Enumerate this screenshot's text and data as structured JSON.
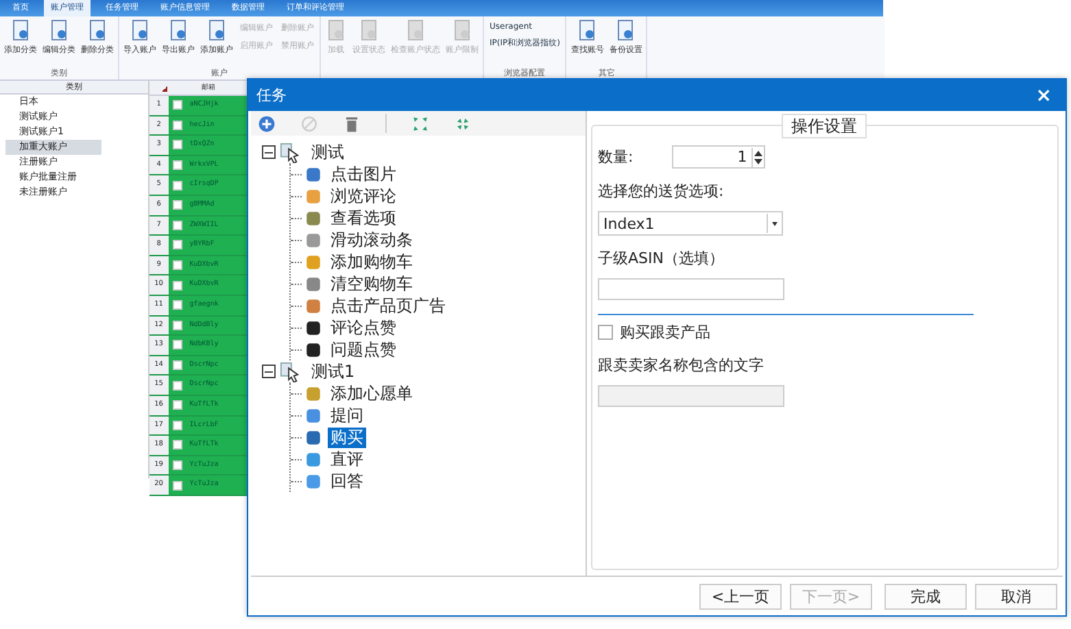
{
  "app": {
    "tabs": [
      {
        "label": "首页",
        "selected": false
      },
      {
        "label": "账户管理",
        "selected": true
      },
      {
        "label": "任务管理",
        "selected": false
      },
      {
        "label": "账户信息管理",
        "selected": false
      },
      {
        "label": "数据管理",
        "selected": false
      },
      {
        "label": "订单和评论管理",
        "selected": false
      }
    ],
    "ribbon_groups": [
      {
        "label": "类别",
        "buttons": [
          {
            "label": "添加分类",
            "disabled": false
          },
          {
            "label": "编辑分类",
            "disabled": false
          },
          {
            "label": "删除分类",
            "disabled": false
          }
        ]
      },
      {
        "label": "账户",
        "buttons": [
          {
            "label": "导入账户",
            "disabled": false
          },
          {
            "label": "导出账户",
            "disabled": false
          },
          {
            "label": "添加账户",
            "disabled": false
          }
        ],
        "small_buttons": [
          {
            "label": "编辑账户",
            "disabled": true
          },
          {
            "label": "启用账户",
            "disabled": true
          },
          {
            "label": "删除账户",
            "disabled": true
          },
          {
            "label": "禁用账户",
            "disabled": true
          }
        ]
      },
      {
        "buttons": [
          {
            "label": "加载",
            "disabled": true
          },
          {
            "label": "设置状态",
            "disabled": true
          },
          {
            "label": "检查账户状态",
            "disabled": true
          },
          {
            "label": "账户限制",
            "disabled": true
          }
        ]
      },
      {
        "label": "浏览器配置",
        "small_buttons": [
          {
            "label": "Useragent",
            "disabled": false
          },
          {
            "label": "IP(IP和浏览器指纹)",
            "disabled": false
          }
        ]
      },
      {
        "label": "其它",
        "buttons": [
          {
            "label": "查找账号",
            "disabled": false
          },
          {
            "label": "备份设置",
            "disabled": false
          }
        ]
      }
    ],
    "category_panel": {
      "header": "类别",
      "items": [
        {
          "label": "日本",
          "selected": false
        },
        {
          "label": "测试账户",
          "selected": false
        },
        {
          "label": "测试账户1",
          "selected": false
        },
        {
          "label": "加重大账户",
          "selected": true
        },
        {
          "label": "注册账户",
          "selected": false
        },
        {
          "label": "账户批量注册",
          "selected": false
        },
        {
          "label": "未注册账户",
          "selected": false
        }
      ]
    },
    "table": {
      "columns": [
        "邮箱"
      ],
      "rows": [
        {
          "num": "1",
          "email": "aNCJHjk",
          "checked": false
        },
        {
          "num": "2",
          "email": "hecJin",
          "checked": false
        },
        {
          "num": "3",
          "email": "tDxQZn",
          "checked": false
        },
        {
          "num": "4",
          "email": "WrkxVPL",
          "checked": false
        },
        {
          "num": "5",
          "email": "cIrsqDP",
          "checked": false
        },
        {
          "num": "6",
          "email": "gBMMAd",
          "checked": false
        },
        {
          "num": "7",
          "email": "ZWXWIIL",
          "checked": false
        },
        {
          "num": "8",
          "email": "yBYRbF",
          "checked": false
        },
        {
          "num": "9",
          "email": "KuDXbvR",
          "checked": false
        },
        {
          "num": "10",
          "email": "KuDXbvR",
          "checked": false
        },
        {
          "num": "11",
          "email": "gfaegnk",
          "checked": false
        },
        {
          "num": "12",
          "email": "NdDdBly",
          "checked": false
        },
        {
          "num": "13",
          "email": "NdbKBly",
          "checked": false
        },
        {
          "num": "14",
          "email": "DscrNpc",
          "checked": false
        },
        {
          "num": "15",
          "email": "DscrNpc",
          "checked": false
        },
        {
          "num": "16",
          "email": "KuTfLTk",
          "checked": false
        },
        {
          "num": "17",
          "email": "ILcrLbF",
          "checked": false
        },
        {
          "num": "18",
          "email": "KuTfLTk",
          "checked": false
        },
        {
          "num": "19",
          "email": "YcTuJza",
          "checked": false
        },
        {
          "num": "20",
          "email": "YcTuJza",
          "checked": false
        }
      ]
    }
  },
  "dialog": {
    "title": "任务",
    "close": "×",
    "tree": [
      {
        "label": "测试",
        "expanded": true,
        "children": [
          {
            "label": "点击图片",
            "selected": false
          },
          {
            "label": "浏览评论",
            "selected": false
          },
          {
            "label": "查看选项",
            "selected": false
          },
          {
            "label": "滑动滚动条",
            "selected": false
          },
          {
            "label": "添加购物车",
            "selected": false
          },
          {
            "label": "清空购物车",
            "selected": false
          },
          {
            "label": "点击产品页广告",
            "selected": false
          },
          {
            "label": "评论点赞",
            "selected": false
          },
          {
            "label": "问题点赞",
            "selected": false
          }
        ]
      },
      {
        "label": "测试1",
        "expanded": true,
        "children": [
          {
            "label": "添加心愿单",
            "selected": false
          },
          {
            "label": "提问",
            "selected": false
          },
          {
            "label": "购买",
            "selected": true
          },
          {
            "label": "直评",
            "selected": false
          },
          {
            "label": "回答",
            "selected": false
          }
        ]
      }
    ],
    "settings": {
      "legend": "操作设置",
      "quantity_label": "数量:",
      "quantity": "1",
      "delivery_label": "选择您的送货选项:",
      "delivery_value": "Index1",
      "asin_label": "子级ASIN（选填）",
      "buy_seller": {
        "label": "购买跟卖产品",
        "checked": false
      },
      "seller_label": "跟卖卖家名称包含的文字",
      "seller_disabled": true
    },
    "buttons": [
      {
        "label": "<上一页",
        "disabled": false
      },
      {
        "label": "下一页>",
        "disabled": true
      },
      {
        "label": "完成",
        "disabled": false
      },
      {
        "label": "取消",
        "disabled": false
      }
    ]
  }
}
